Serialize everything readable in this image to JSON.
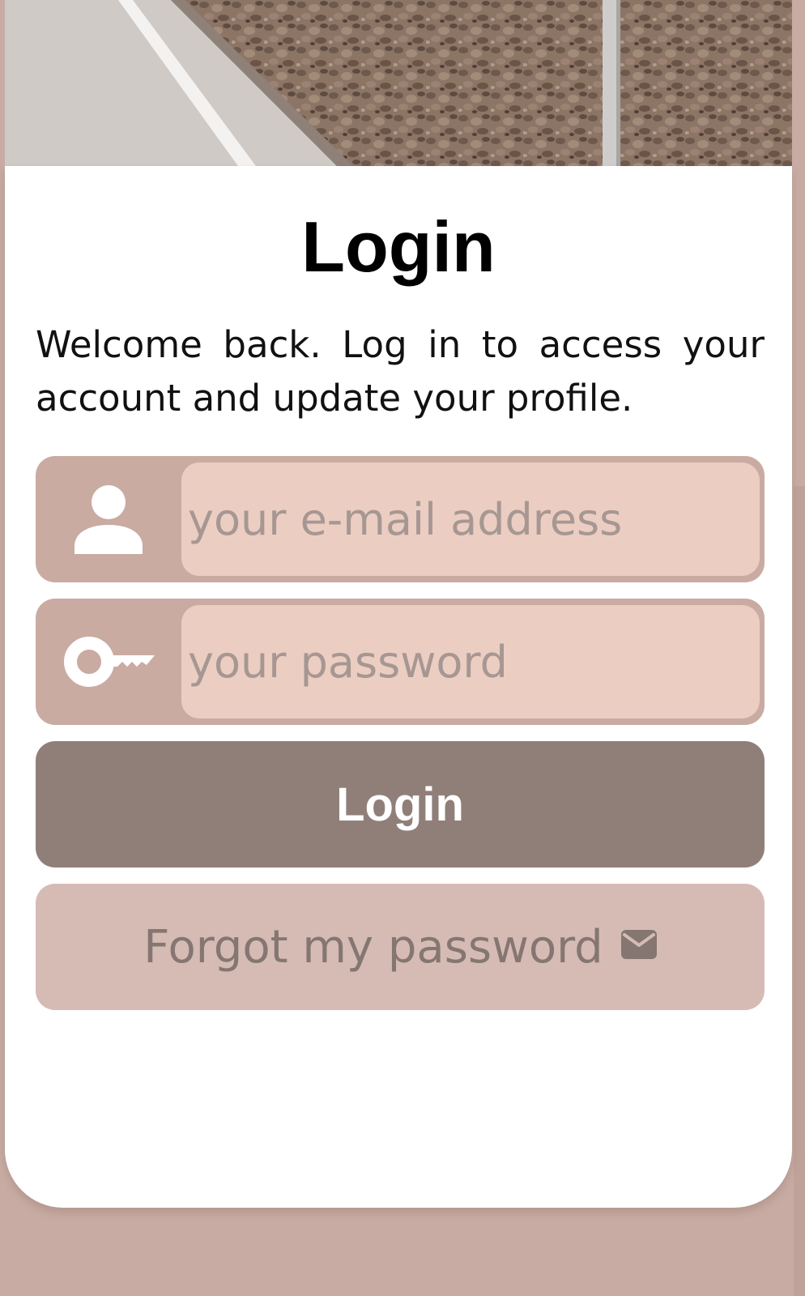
{
  "hero": {
    "image": "road-and-rocky-field-photo"
  },
  "login_card": {
    "title": "Login",
    "subtitle": "Welcome back. Log in to access your account and update your profile.",
    "email_field": {
      "icon": "user-icon",
      "placeholder": "your e-mail address",
      "value": ""
    },
    "password_field": {
      "icon": "key-icon",
      "placeholder": "your password",
      "value": ""
    },
    "login_button": {
      "label": "Login"
    },
    "forgot_button": {
      "label": "Forgot my password",
      "icon": "envelope-icon"
    }
  },
  "colors": {
    "background": "#c8aca3",
    "card": "#ffffff",
    "field_icon_bg": "#c9aba2",
    "field_input_bg": "#ebcdc2",
    "primary_button": "#907f79",
    "secondary_button": "#d5bbb4",
    "secondary_text": "#857672",
    "placeholder": "#a79792"
  }
}
